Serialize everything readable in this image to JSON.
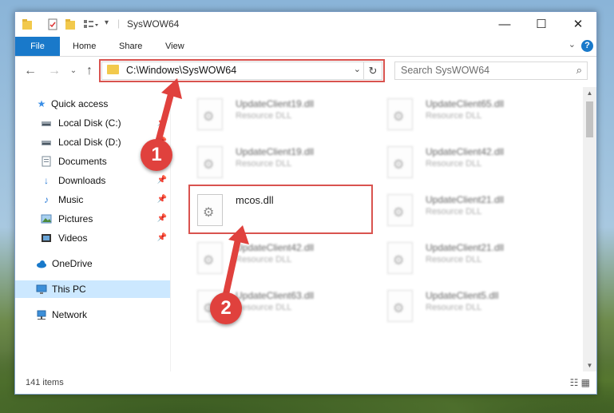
{
  "titlebar": {
    "title": "SysWOW64",
    "minimize": "—",
    "maximize": "☐",
    "close": "✕"
  },
  "ribbon": {
    "tabs": [
      {
        "label": "File"
      },
      {
        "label": "Home"
      },
      {
        "label": "Share"
      },
      {
        "label": "View"
      }
    ],
    "help": "?"
  },
  "navbar": {
    "address": "C:\\Windows\\SysWOW64",
    "search_placeholder": "Search SysWOW64"
  },
  "sidebar": {
    "items": [
      {
        "label": "Quick access",
        "icon": "star-icon",
        "pinned": false
      },
      {
        "label": "Local Disk (C:)",
        "icon": "drive-icon",
        "pinned": true
      },
      {
        "label": "Local Disk (D:)",
        "icon": "drive-icon",
        "pinned": true
      },
      {
        "label": "Documents",
        "icon": "documents-icon",
        "pinned": true
      },
      {
        "label": "Downloads",
        "icon": "download-icon",
        "pinned": true
      },
      {
        "label": "Music",
        "icon": "music-icon",
        "pinned": true
      },
      {
        "label": "Pictures",
        "icon": "pictures-icon",
        "pinned": true
      },
      {
        "label": "Videos",
        "icon": "videos-icon",
        "pinned": true
      },
      {
        "label": "OneDrive",
        "icon": "cloud-icon",
        "pinned": false
      },
      {
        "label": "This PC",
        "icon": "computer-icon",
        "pinned": false,
        "selected": true
      },
      {
        "label": "Network",
        "icon": "network-icon",
        "pinned": false
      }
    ]
  },
  "files": {
    "left": [
      {
        "name": "UpdateClient19.dll",
        "type": "Resource DLL"
      },
      {
        "name": "UpdateClient19.dll",
        "type": "Resource DLL"
      },
      {
        "name": "mcos.dll",
        "type": ""
      },
      {
        "name": "UpdateClient42.dll",
        "type": "Resource DLL"
      },
      {
        "name": "UpdateClient63.dll",
        "type": "Resource DLL"
      }
    ],
    "right": [
      {
        "name": "UpdateClient65.dll",
        "type": "Resource DLL"
      },
      {
        "name": "UpdateClient42.dll",
        "type": "Resource DLL"
      },
      {
        "name": "UpdateClient21.dll",
        "type": "Resource DLL"
      },
      {
        "name": "UpdateClient21.dll",
        "type": "Resource DLL"
      },
      {
        "name": "UpdateClient5.dll",
        "type": "Resource DLL"
      }
    ]
  },
  "status": {
    "count": "141 items"
  },
  "callouts": [
    "1",
    "2"
  ],
  "colors": {
    "accent": "#1979ca",
    "highlight": "#d9534f",
    "selected": "#cce8ff"
  }
}
